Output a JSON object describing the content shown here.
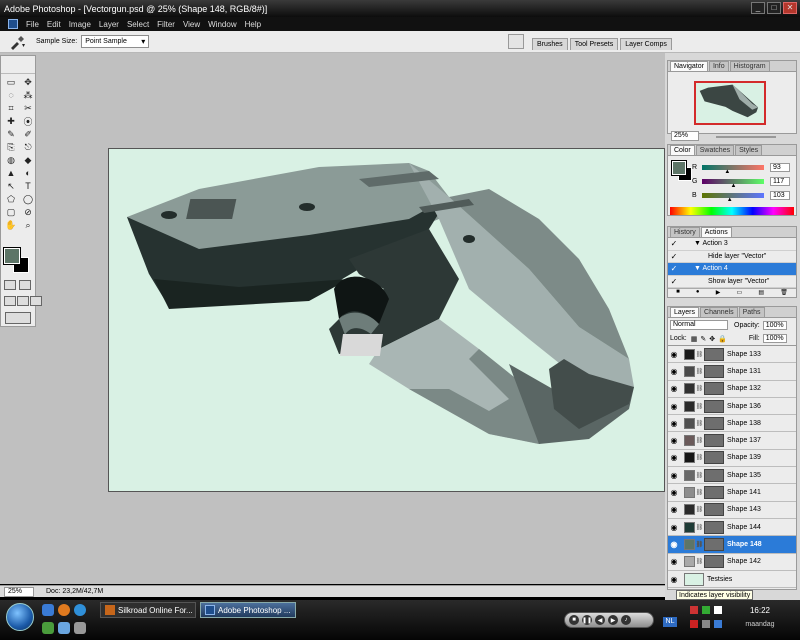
{
  "window": {
    "title": "Adobe Photoshop - [Vectorgun.psd @ 25% (Shape 148, RGB/8#)]",
    "buttons": [
      "_",
      "□",
      "✕"
    ]
  },
  "menu": [
    "File",
    "Edit",
    "Image",
    "Layer",
    "Select",
    "Filter",
    "View",
    "Window",
    "Help"
  ],
  "options": {
    "sample_size_label": "Sample Size:",
    "sample_size_value": "Point Sample"
  },
  "palette_well": [
    "Brushes",
    "Tool Presets",
    "Layer Comps"
  ],
  "tools_glyphs": [
    "▭",
    "✥",
    "◌",
    "⁂",
    "⌗",
    "✂",
    "✚",
    "⦿",
    "✎",
    "✐",
    "⎘",
    "⎋",
    "◍",
    "◆",
    "▲",
    "◐",
    "↖",
    "T",
    "⬠",
    "◯",
    "▢",
    "⊘",
    "✋",
    "⌕"
  ],
  "status": {
    "zoom": "25%",
    "doc": "Doc: 23,2M/42,7M"
  },
  "navigator": {
    "tabs": [
      "Navigator",
      "Info",
      "Histogram"
    ],
    "zoom": "25%"
  },
  "color_panel": {
    "tabs": [
      "Color",
      "Swatches",
      "Styles"
    ],
    "channels": [
      {
        "label": "R",
        "value": "93",
        "bar": "linear-gradient(90deg,#007567,#ff7567)",
        "fill": 0.36
      },
      {
        "label": "G",
        "value": "117",
        "bar": "linear-gradient(90deg,#5d0067,#5dff67)",
        "fill": 0.46
      },
      {
        "label": "B",
        "value": "103",
        "bar": "linear-gradient(90deg,#5d7500,#5d75ff)",
        "fill": 0.4
      }
    ],
    "fg_color": "#5d7567"
  },
  "actions_panel": {
    "tabs": [
      "History",
      "Actions"
    ],
    "rows": [
      {
        "check": "✓",
        "label": "▼ Action 3",
        "indent": 1,
        "selected": false
      },
      {
        "check": "✓",
        "label": "Hide layer \"Vector\"",
        "indent": 2,
        "selected": false
      },
      {
        "check": "✓",
        "label": "▼ Action 4",
        "indent": 1,
        "selected": true
      },
      {
        "check": "✓",
        "label": "Show layer \"Vector\"",
        "indent": 2,
        "selected": false
      }
    ]
  },
  "layers_panel": {
    "tabs": [
      "Layers",
      "Channels",
      "Paths"
    ],
    "blend": "Normal",
    "opacity_label": "Opacity:",
    "opacity": "100%",
    "lock_label": "Lock:",
    "fill_label": "Fill:",
    "fill": "100%",
    "layers": [
      {
        "name": "Shape 133",
        "color": "#1a1a1a",
        "selected": false
      },
      {
        "name": "Shape 131",
        "color": "#4a4a4a",
        "selected": false
      },
      {
        "name": "Shape 132",
        "color": "#303030",
        "selected": false
      },
      {
        "name": "Shape 136",
        "color": "#2a2a2a",
        "selected": false
      },
      {
        "name": "Shape 138",
        "color": "#505050",
        "selected": false
      },
      {
        "name": "Shape 137",
        "color": "#6a5a5a",
        "selected": false
      },
      {
        "name": "Shape 139",
        "color": "#151515",
        "selected": false
      },
      {
        "name": "Shape 135",
        "color": "#686868",
        "selected": false
      },
      {
        "name": "Shape 141",
        "color": "#8d8d8d",
        "selected": false
      },
      {
        "name": "Shape 143",
        "color": "#2b2b2b",
        "selected": false
      },
      {
        "name": "Shape 144",
        "color": "#1e3b36",
        "selected": false
      },
      {
        "name": "Shape 148",
        "color": "#5d7567",
        "selected": true
      },
      {
        "name": "Shape 142",
        "color": "#a9a9a9",
        "selected": false
      }
    ],
    "background_layer": "Testsies",
    "tooltip": "Indicates layer visibility"
  },
  "taskbar": {
    "tasks": [
      {
        "label": "Silkroad Online For...",
        "active": false
      },
      {
        "label": "Adobe Photoshop ...",
        "active": true
      }
    ],
    "lang": "NL",
    "clock": "16:22",
    "day": "maandag"
  }
}
